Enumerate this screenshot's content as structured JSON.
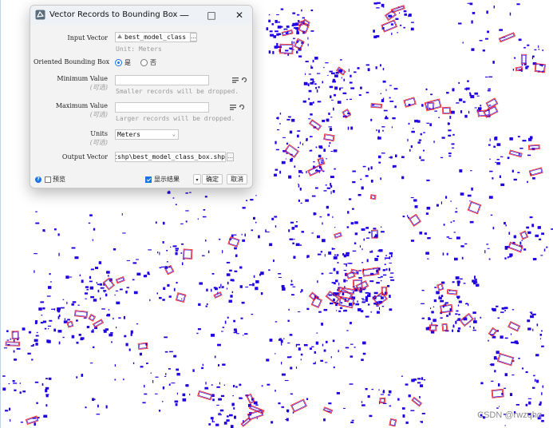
{
  "dialog": {
    "title": "Vector Records to Bounding Box",
    "icons": {
      "app": "vector-app-icon",
      "minimize": "minimize-icon",
      "maximize": "maximize-icon",
      "close": "close-icon"
    },
    "input_vector": {
      "label": "Input Vector",
      "value": "best_model_class",
      "unit_hint": "Unit: Meters"
    },
    "oriented_bbox": {
      "label": "Oriented Bounding Box",
      "option_yes": "是",
      "option_no": "否",
      "selected": "是"
    },
    "minimum_value": {
      "label": "Minimum Value",
      "optional": "(可选)",
      "value": "",
      "hint": "Smaller records will be dropped."
    },
    "maximum_value": {
      "label": "Maximum Value",
      "optional": "(可选)",
      "value": "",
      "hint": "Larger records will be dropped."
    },
    "units": {
      "label": "Units",
      "optional": "(可选)",
      "value": "Meters"
    },
    "output_vector": {
      "label": "Output Vector",
      "value": "outshp\\best_model_class_box.shp"
    },
    "footer": {
      "preview_label": "预览",
      "preview_checked": false,
      "show_result_label": "显示结果",
      "show_result_checked": true,
      "ok_label": "确定",
      "cancel_label": "取消"
    }
  },
  "watermark": "CSDN @rwzqhq",
  "colors": {
    "features_fill": "#1f00e0",
    "bbox_outline": "#ff1a1a",
    "accent": "#1a73e8"
  }
}
